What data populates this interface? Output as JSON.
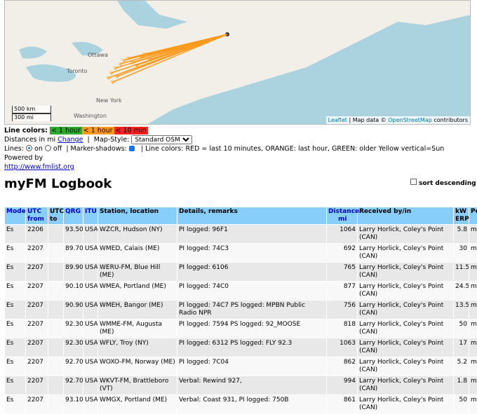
{
  "map": {
    "city_labels": [
      "Ottawa",
      "Toronto",
      "New York",
      "Washington"
    ],
    "scale": [
      "500 km",
      "300 mi"
    ],
    "attribution": {
      "leaflet": "Leaflet",
      "sep": "| Map data ©",
      "osm": "OpenStreetMap",
      "contrib": "contributors"
    },
    "colors": {
      "water": "#aad3df",
      "land": "#f2efe9",
      "line_orange": "#ff9a1e"
    }
  },
  "controls": {
    "line_colors_label": "Line colors:",
    "legend": [
      "< 1 hour",
      "< 1 hour",
      "< 10 min"
    ],
    "distances_label": "Distances in mi",
    "change_link": "Change",
    "map_style_label": "Map-Style:",
    "map_style_value": "Standard OSM",
    "lines_label": "Lines:",
    "on_label": "on",
    "off_label": "off",
    "marker_shadows_label": "Marker-shadows:",
    "info": "Line colors: RED = last 10 minutes, ORANGE: last hour, GREEN: older     Yellow vertical=Sun    Powered by",
    "powered_link": "http://www.fmlist.org"
  },
  "title": "myFM Logbook",
  "sort_label": "sort descending",
  "table": {
    "headers": {
      "mode": "Mode",
      "utc1": "UTC",
      "utc2": "from",
      "utcto1": "UTC",
      "utcto2": "to",
      "qrg": "QRG",
      "itu": "ITU",
      "station": "Station, location",
      "details": "Details, remarks",
      "dist1": "Distance",
      "dist2": "mi",
      "recv": "Received by/in",
      "kw1": "kW",
      "kw2": "ERP",
      "pol": "Pol"
    },
    "rows": [
      {
        "mode": "Es",
        "utc": "2206",
        "qrg": "93.50",
        "itu": "USA",
        "station": "WZCR, Hudson (NY)",
        "details": "PI logged: 96F1",
        "dist": "1064",
        "recv": "Larry Horlick, Coley's Point (CAN)",
        "kw": "5.8",
        "pol": "m"
      },
      {
        "mode": "Es",
        "utc": "2207",
        "qrg": "89.70",
        "itu": "USA",
        "station": "WMED, Calais (ME)",
        "details": "PI logged: 74C3",
        "dist": "692",
        "recv": "Larry Horlick, Coley's Point (CAN)",
        "kw": "30",
        "pol": "m"
      },
      {
        "mode": "Es",
        "utc": "2207",
        "qrg": "89.90",
        "itu": "USA",
        "station": "WERU-FM, Blue Hill (ME)",
        "details": "PI logged: 6106",
        "dist": "765",
        "recv": "Larry Horlick, Coley's Point (CAN)",
        "kw": "11.5",
        "pol": "m"
      },
      {
        "mode": "Es",
        "utc": "2207",
        "qrg": "90.10",
        "itu": "USA",
        "station": "WMEA, Portland (ME)",
        "details": "PI logged: 74C0",
        "dist": "877",
        "recv": "Larry Horlick, Coley's Point (CAN)",
        "kw": "24.5",
        "pol": "m"
      },
      {
        "mode": "Es",
        "utc": "2207",
        "qrg": "90.90",
        "itu": "USA",
        "station": "WMEH, Bangor (ME)",
        "details": "PI logged: 74C7 PS logged: MPBN Public Radio NPR",
        "dist": "756",
        "recv": "Larry Horlick, Coley's Point (CAN)",
        "kw": "13.5",
        "pol": "m"
      },
      {
        "mode": "Es",
        "utc": "2207",
        "qrg": "92.30",
        "itu": "USA",
        "station": "WMME-FM, Augusta (ME)",
        "details": "PI logged: 7594 PS logged: 92_MOOSE",
        "dist": "818",
        "recv": "Larry Horlick, Coley's Point (CAN)",
        "kw": "50",
        "pol": "m"
      },
      {
        "mode": "Es",
        "utc": "2207",
        "qrg": "92.30",
        "itu": "USA",
        "station": "WFLY, Troy (NY)",
        "details": "PI logged: 6312 PS logged: FLY 92.3",
        "dist": "1063",
        "recv": "Larry Horlick, Coley's Point (CAN)",
        "kw": "17",
        "pol": "m"
      },
      {
        "mode": "Es",
        "utc": "2207",
        "qrg": "92.70",
        "itu": "USA",
        "station": "WOXO-FM, Norway (ME)",
        "details": "PI logged: 7C04",
        "dist": "862",
        "recv": "Larry Horlick, Coley's Point (CAN)",
        "kw": "5.2",
        "pol": "m"
      },
      {
        "mode": "Es",
        "utc": "2207",
        "qrg": "92.70",
        "itu": "USA",
        "station": "WKVT-FM, Brattleboro (VT)",
        "details": "Verbal: Rewind 927,",
        "dist": "994",
        "recv": "Larry Horlick, Coley's Point (CAN)",
        "kw": "1.8",
        "pol": "m"
      },
      {
        "mode": "Es",
        "utc": "2207",
        "qrg": "93.10",
        "itu": "USA",
        "station": "WMGX, Portland (ME)",
        "details": "Verbal: Coast 931, PI logged: 750B",
        "dist": "861",
        "recv": "Larry Horlick, Coley's Point (CAN)",
        "kw": "50",
        "pol": "m"
      }
    ]
  }
}
